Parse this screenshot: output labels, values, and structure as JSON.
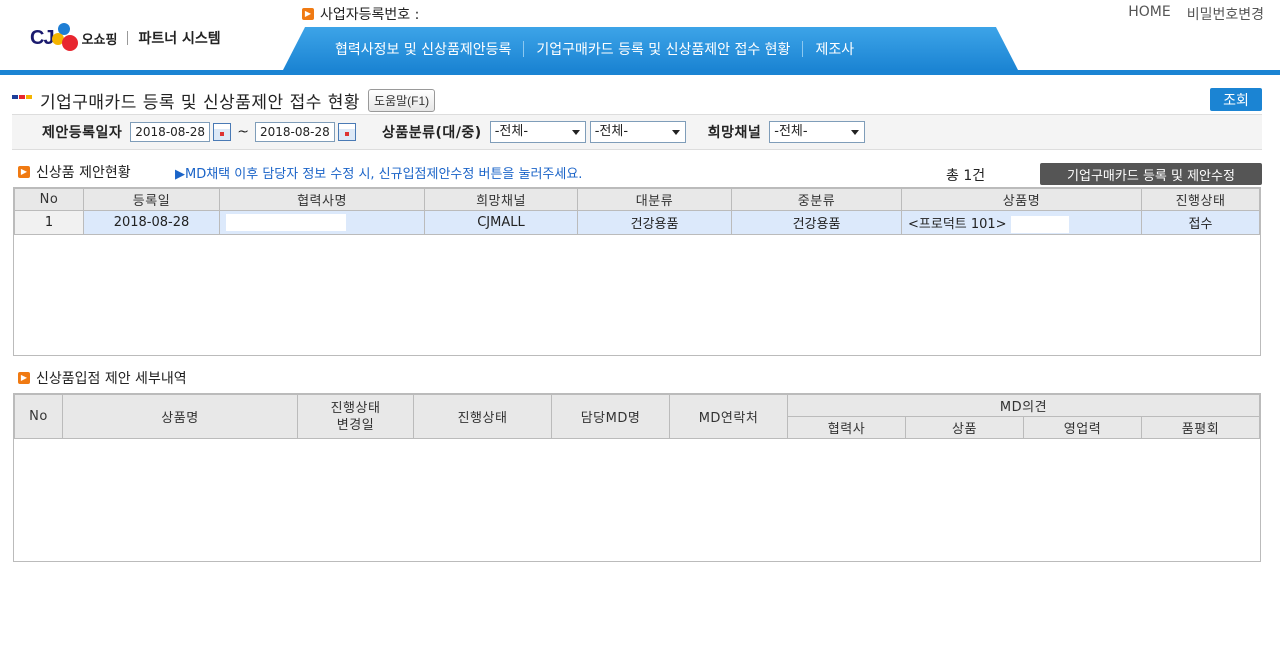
{
  "header": {
    "logo_cj": "CJ",
    "logo_shop": "오쇼핑",
    "logo_partner": "파트너 시스템",
    "bizno_label": "사업자등록번호 :",
    "links": {
      "home": "HOME",
      "password": "비밀번호변경"
    },
    "nav": [
      "협력사정보 및 신상품제안등록",
      "기업구매카드 등록 및 신상품제안 접수 현황",
      "제조사"
    ]
  },
  "page": {
    "title": "기업구매카드 등록 및 신상품제안 접수 현황",
    "help_label": "도움말(F1)",
    "search_label": "조회"
  },
  "filter": {
    "date_label": "제안등록일자",
    "date_from": "2018-08-28",
    "date_sep": "~",
    "date_to": "2018-08-28",
    "category_label": "상품분류(대/중)",
    "category_large": "-전체-",
    "category_mid": "-전체-",
    "channel_label": "희망채널",
    "channel_value": "-전체-"
  },
  "proposal": {
    "section_title": "신상품 제안현황",
    "notice": "▶MD채택 이후 담당자 정보 수정 시, 신규입점제안수정 버튼을 눌러주세요.",
    "total": "총 1건",
    "edit_button": "기업구매카드 등록 및 제안수정",
    "columns": [
      "No",
      "등록일",
      "협력사명",
      "희망채널",
      "대분류",
      "중분류",
      "상품명",
      "진행상태"
    ],
    "rows": [
      {
        "no": "1",
        "date": "2018-08-28",
        "partner": "",
        "channel": "CJMALL",
        "large": "건강용품",
        "mid": "건강용품",
        "product": "<프로덕트 101>",
        "status": "접수"
      }
    ]
  },
  "detail": {
    "section_title": "신상품입점 제안 세부내역",
    "columns": {
      "no": "No",
      "product": "상품명",
      "status_date_1": "진행상태",
      "status_date_2": "변경일",
      "status": "진행상태",
      "md": "담당MD명",
      "md_contact": "MD연락처",
      "md_opinion": "MD의견"
    },
    "opinion_columns": [
      "협력사",
      "상품",
      "영업력",
      "품평회"
    ]
  },
  "colors": {
    "accent": "#1b84d3",
    "orange": "#f07a12",
    "row_highlight": "#dce9fb"
  }
}
